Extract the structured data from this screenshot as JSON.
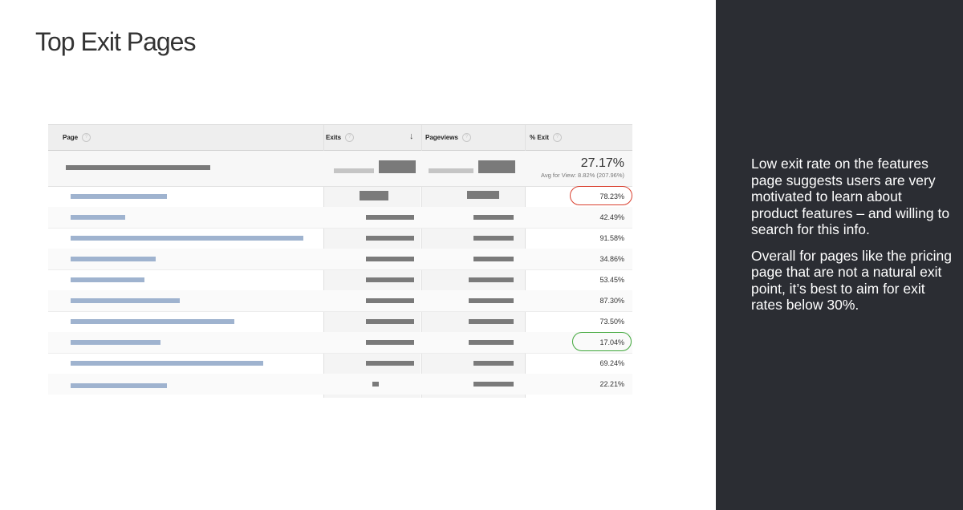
{
  "title": "Top Exit Pages",
  "table": {
    "columns": {
      "page": "Page",
      "exits": "Exits",
      "pageviews": "Pageviews",
      "pct_exit": "% Exit"
    },
    "total": {
      "pct_exit": "27.17%",
      "avg_note": "Avg for View: 8.82% (207.96%)"
    },
    "rows": [
      {
        "pct_exit": "78.23%"
      },
      {
        "pct_exit": "42.49%"
      },
      {
        "pct_exit": "91.58%"
      },
      {
        "pct_exit": "34.86%"
      },
      {
        "pct_exit": "53.45%"
      },
      {
        "pct_exit": "87.30%"
      },
      {
        "pct_exit": "73.50%"
      },
      {
        "pct_exit": "17.04%"
      },
      {
        "pct_exit": "69.24%"
      },
      {
        "pct_exit": "22.21%"
      }
    ],
    "highlight_colors": {
      "high": "#d9402f",
      "low": "#3fa73a"
    }
  },
  "side_panel": {
    "paragraph1": "Low exit rate on the features page suggests users are very motivated to learn about product features – and willing to search for this info.",
    "paragraph2": "Overall for pages like the pricing page that are not a natural exit point, it’s best to aim for exit rates below 30%."
  }
}
